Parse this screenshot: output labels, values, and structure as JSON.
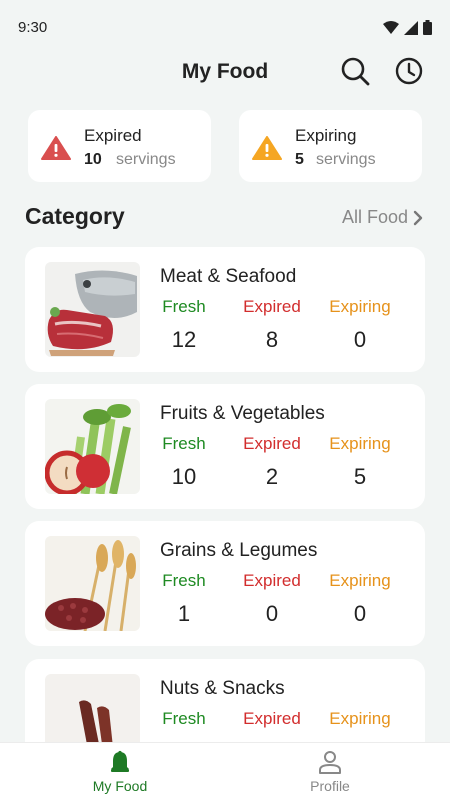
{
  "status_bar": {
    "time": "9:30"
  },
  "header": {
    "title": "My Food",
    "search_icon": "search-icon",
    "history_icon": "clock-icon"
  },
  "summary": {
    "expired": {
      "title": "Expired",
      "count": "10",
      "unit": "servings",
      "color": "#d94f4f"
    },
    "expiring": {
      "title": "Expiring",
      "count": "5",
      "unit": "servings",
      "color": "#f5a623"
    }
  },
  "category": {
    "title": "Category",
    "link_label": "All Food"
  },
  "labels": {
    "fresh": "Fresh",
    "expired": "Expired",
    "expiring": "Expiring"
  },
  "colors": {
    "fresh": "#1e8a22",
    "expired": "#d22d2d",
    "expiring": "#e6921b",
    "tab_active": "#1e7a25",
    "tab_inactive": "#888888"
  },
  "categories": [
    {
      "name": "Meat & Seafood",
      "fresh": "12",
      "expired": "8",
      "expiring": "0",
      "image": "meat-fish-image"
    },
    {
      "name": "Fruits & Vegetables",
      "fresh": "10",
      "expired": "2",
      "expiring": "5",
      "image": "celery-apple-image"
    },
    {
      "name": "Grains & Legumes",
      "fresh": "1",
      "expired": "0",
      "expiring": "0",
      "image": "wheat-beans-image"
    },
    {
      "name": "Nuts & Snacks",
      "fresh": "",
      "expired": "",
      "expiring": "",
      "image": "jerky-nuts-image"
    }
  ],
  "tabs": [
    {
      "label": "My Food",
      "icon": "bell-icon",
      "active": true
    },
    {
      "label": "Profile",
      "icon": "person-icon",
      "active": false
    }
  ]
}
